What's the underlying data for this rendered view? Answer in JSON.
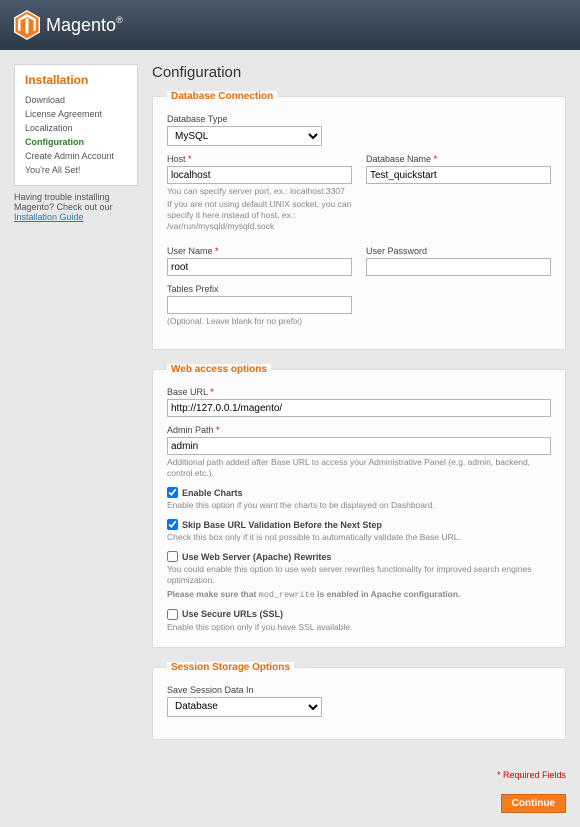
{
  "brand": "Magento",
  "sidebar": {
    "title": "Installation",
    "items": [
      {
        "label": "Download"
      },
      {
        "label": "License Agreement"
      },
      {
        "label": "Localization"
      },
      {
        "label": "Configuration",
        "active": true
      },
      {
        "label": "Create Admin Account"
      },
      {
        "label": "You're All Set!"
      }
    ],
    "help_prefix": "Having trouble installing Magento? Check out our ",
    "help_link": "Installation Guide"
  },
  "page": {
    "title": "Configuration"
  },
  "db": {
    "legend": "Database Connection",
    "type_label": "Database Type",
    "type_value": "MySQL",
    "host_label": "Host",
    "host_value": "localhost",
    "host_hint1": "You can specify server port, ex.: localhost:3307",
    "host_hint2": "If you are not using default UNIX socket, you can specify it here instead of host, ex.: /var/run/mysqld/mysqld.sock",
    "name_label": "Database Name",
    "name_value": "Test_quickstart",
    "user_label": "User Name",
    "user_value": "root",
    "pass_label": "User Password",
    "pass_value": "",
    "prefix_label": "Tables Prefix",
    "prefix_value": "",
    "prefix_hint": "(Optional. Leave blank for no prefix)"
  },
  "web": {
    "legend": "Web access options",
    "base_label": "Base URL",
    "base_value": "http://127.0.0.1/magento/",
    "admin_label": "Admin Path",
    "admin_value": "admin",
    "admin_hint": "Additional path added after Base URL to access your Administrative Panel (e.g. admin, backend, control etc.).",
    "charts_label": "Enable Charts",
    "charts_hint": "Enable this option if you want the charts to be displayed on Dashboard.",
    "skip_label": "Skip Base URL Validation Before the Next Step",
    "skip_hint": "Check this box only if it is not possible to automatically validate the Base URL.",
    "rewrites_label": "Use Web Server (Apache) Rewrites",
    "rewrites_hint1": "You could enable this option to use web server rewrites functionality for improved search engines optimization.",
    "rewrites_hint2_prefix": "Please make sure that ",
    "rewrites_hint2_code": "mod_rewrite",
    "rewrites_hint2_suffix": " is enabled in Apache configuration.",
    "ssl_label": "Use Secure URLs (SSL)",
    "ssl_hint": "Enable this option only if you have SSL available."
  },
  "session": {
    "legend": "Session Storage Options",
    "label": "Save Session Data In",
    "value": "Database"
  },
  "footer": {
    "required": "* Required Fields",
    "continue": "Continue"
  }
}
